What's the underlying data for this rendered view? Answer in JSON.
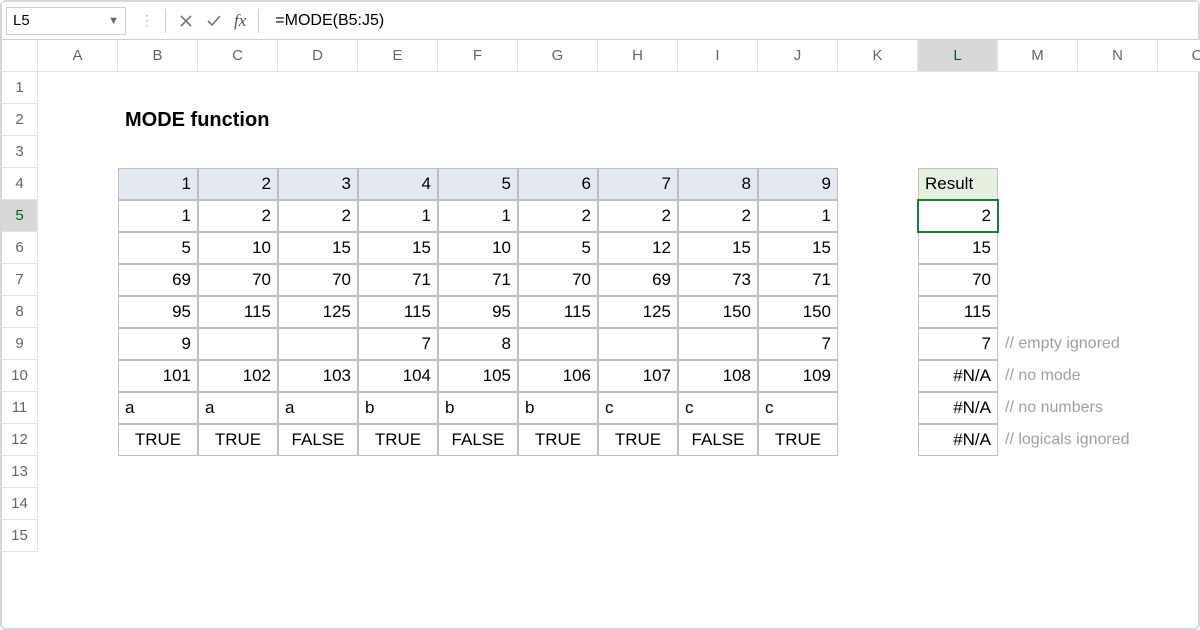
{
  "nameBox": "L5",
  "formula": "=MODE(B5:J5)",
  "title": "MODE function",
  "columnLetters": [
    "A",
    "B",
    "C",
    "D",
    "E",
    "F",
    "G",
    "H",
    "I",
    "J",
    "K",
    "L",
    "M",
    "N",
    "O"
  ],
  "rowNumbers": [
    "1",
    "2",
    "3",
    "4",
    "5",
    "6",
    "7",
    "8",
    "9",
    "10",
    "11",
    "12",
    "13",
    "14",
    "15"
  ],
  "selectedCol": "L",
  "selectedRow": "5",
  "headers": {
    "b": "1",
    "c": "2",
    "d": "3",
    "e": "4",
    "f": "5",
    "g": "6",
    "h": "7",
    "i": "8",
    "j": "9"
  },
  "resultLabel": "Result",
  "row5": {
    "b": "1",
    "c": "2",
    "d": "2",
    "e": "1",
    "f": "1",
    "g": "2",
    "h": "2",
    "i": "2",
    "j": "1",
    "l": "2"
  },
  "row6": {
    "b": "5",
    "c": "10",
    "d": "15",
    "e": "15",
    "f": "10",
    "g": "5",
    "h": "12",
    "i": "15",
    "j": "15",
    "l": "15"
  },
  "row7": {
    "b": "69",
    "c": "70",
    "d": "70",
    "e": "71",
    "f": "71",
    "g": "70",
    "h": "69",
    "i": "73",
    "j": "71",
    "l": "70"
  },
  "row8": {
    "b": "95",
    "c": "115",
    "d": "125",
    "e": "115",
    "f": "95",
    "g": "115",
    "h": "125",
    "i": "150",
    "j": "150",
    "l": "115"
  },
  "row9": {
    "b": "9",
    "c": "",
    "d": "",
    "e": "7",
    "f": "8",
    "g": "",
    "h": "",
    "i": "",
    "j": "7",
    "l": "7"
  },
  "row10": {
    "b": "101",
    "c": "102",
    "d": "103",
    "e": "104",
    "f": "105",
    "g": "106",
    "h": "107",
    "i": "108",
    "j": "109",
    "l": "#N/A"
  },
  "row11": {
    "b": "a",
    "c": "a",
    "d": "a",
    "e": "b",
    "f": "b",
    "g": "b",
    "h": "c",
    "i": "c",
    "j": "c",
    "l": "#N/A"
  },
  "row12": {
    "b": "TRUE",
    "c": "TRUE",
    "d": "FALSE",
    "e": "TRUE",
    "f": "FALSE",
    "g": "TRUE",
    "h": "TRUE",
    "i": "FALSE",
    "j": "TRUE",
    "l": "#N/A"
  },
  "comments": {
    "r9": "// empty ignored",
    "r10": "// no mode",
    "r11": "// no numbers",
    "r12": "// logicals ignored"
  },
  "chart_data": {
    "type": "table",
    "title": "MODE function",
    "columns": [
      "1",
      "2",
      "3",
      "4",
      "5",
      "6",
      "7",
      "8",
      "9",
      "Result"
    ],
    "rows": [
      [
        1,
        2,
        2,
        1,
        1,
        2,
        2,
        2,
        1,
        2
      ],
      [
        5,
        10,
        15,
        15,
        10,
        5,
        12,
        15,
        15,
        15
      ],
      [
        69,
        70,
        70,
        71,
        71,
        70,
        69,
        73,
        71,
        70
      ],
      [
        95,
        115,
        125,
        115,
        95,
        115,
        125,
        150,
        150,
        115
      ],
      [
        9,
        null,
        null,
        7,
        8,
        null,
        null,
        null,
        7,
        7
      ],
      [
        101,
        102,
        103,
        104,
        105,
        106,
        107,
        108,
        109,
        "#N/A"
      ],
      [
        "a",
        "a",
        "a",
        "b",
        "b",
        "b",
        "c",
        "c",
        "c",
        "#N/A"
      ],
      [
        "TRUE",
        "TRUE",
        "FALSE",
        "TRUE",
        "FALSE",
        "TRUE",
        "TRUE",
        "FALSE",
        "TRUE",
        "#N/A"
      ]
    ],
    "notes": [
      "empty ignored",
      "no mode",
      "no numbers",
      "logicals ignored"
    ]
  }
}
